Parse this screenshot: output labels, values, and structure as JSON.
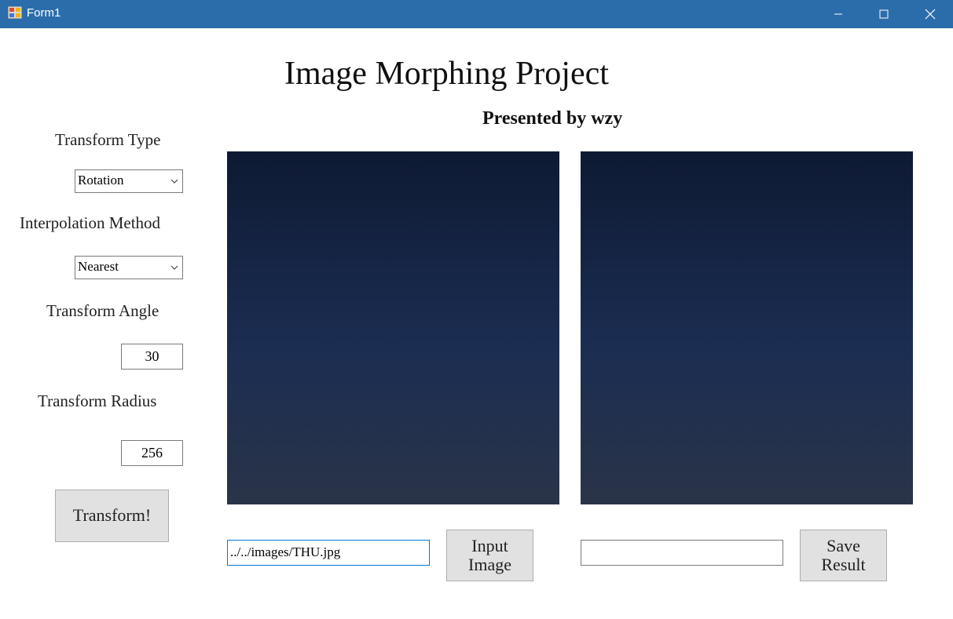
{
  "window": {
    "title": "Form1"
  },
  "header": {
    "title": "Image Morphing Project",
    "subtitle": "Presented by wzy"
  },
  "controls": {
    "transform_type_label": "Transform Type",
    "transform_type_value": "Rotation",
    "interp_label": "Interpolation Method",
    "interp_value": "Nearest",
    "angle_label": "Transform Angle",
    "angle_value": "30",
    "radius_label": "Transform Radius",
    "radius_value": "256",
    "transform_button": "Transform!"
  },
  "input": {
    "path": "../../images/THU.jpg",
    "button": "Input\nImage"
  },
  "output": {
    "path": "",
    "button": "Save\nResult"
  },
  "colors": {
    "titlebar": "#2b6dab",
    "button": "#e1e1e1",
    "focus_border": "#0078d7"
  }
}
